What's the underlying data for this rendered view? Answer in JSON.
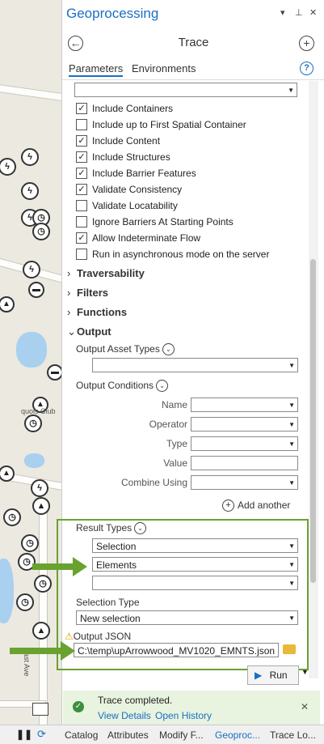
{
  "pane": {
    "title": "Geoprocessing",
    "controls": {
      "dropdown": "▾",
      "pin": "⊥",
      "close": "✕"
    },
    "tool_title": "Trace",
    "tabs": [
      "Parameters",
      "Environments"
    ]
  },
  "options": [
    {
      "label": "Include Containers",
      "checked": true
    },
    {
      "label": "Include up to First Spatial Container",
      "checked": false
    },
    {
      "label": "Include Content",
      "checked": true
    },
    {
      "label": "Include Structures",
      "checked": true
    },
    {
      "label": "Include Barrier Features",
      "checked": true
    },
    {
      "label": "Validate Consistency",
      "checked": true
    },
    {
      "label": "Validate Locatability",
      "checked": false
    },
    {
      "label": "Ignore Barriers At Starting Points",
      "checked": false
    },
    {
      "label": "Allow Indeterminate Flow",
      "checked": true
    },
    {
      "label": "Run in asynchronous mode on the server",
      "checked": false
    }
  ],
  "sections": [
    "Traversability",
    "Filters",
    "Functions",
    "Output"
  ],
  "output": {
    "asset_types_label": "Output Asset Types",
    "conditions_label": "Output Conditions",
    "conditions": [
      "Name",
      "Operator",
      "Type",
      "Value",
      "Combine Using"
    ],
    "add_another": "Add another",
    "result_types_label": "Result Types",
    "result_types": [
      "Selection",
      "Elements",
      ""
    ],
    "selection_type_label": "Selection Type",
    "selection_type": "New selection",
    "json_label": "Output JSON",
    "json_value": "C:\\temp\\upArrowwood_MV1020_EMNTS.json"
  },
  "run_label": "Run",
  "status": {
    "message": "Trace completed.",
    "view_details": "View Details",
    "open_history": "Open History"
  },
  "map": {
    "labels": [
      "quois Club",
      "ast Ave"
    ]
  },
  "bottom_tabs": [
    "Catalog",
    "Attributes",
    "Modify F...",
    "Geoproc...",
    "Trace Lo..."
  ],
  "colors": {
    "accent": "#1a6fc2",
    "highlight": "#6aa22f",
    "warning": "#e0a000"
  }
}
